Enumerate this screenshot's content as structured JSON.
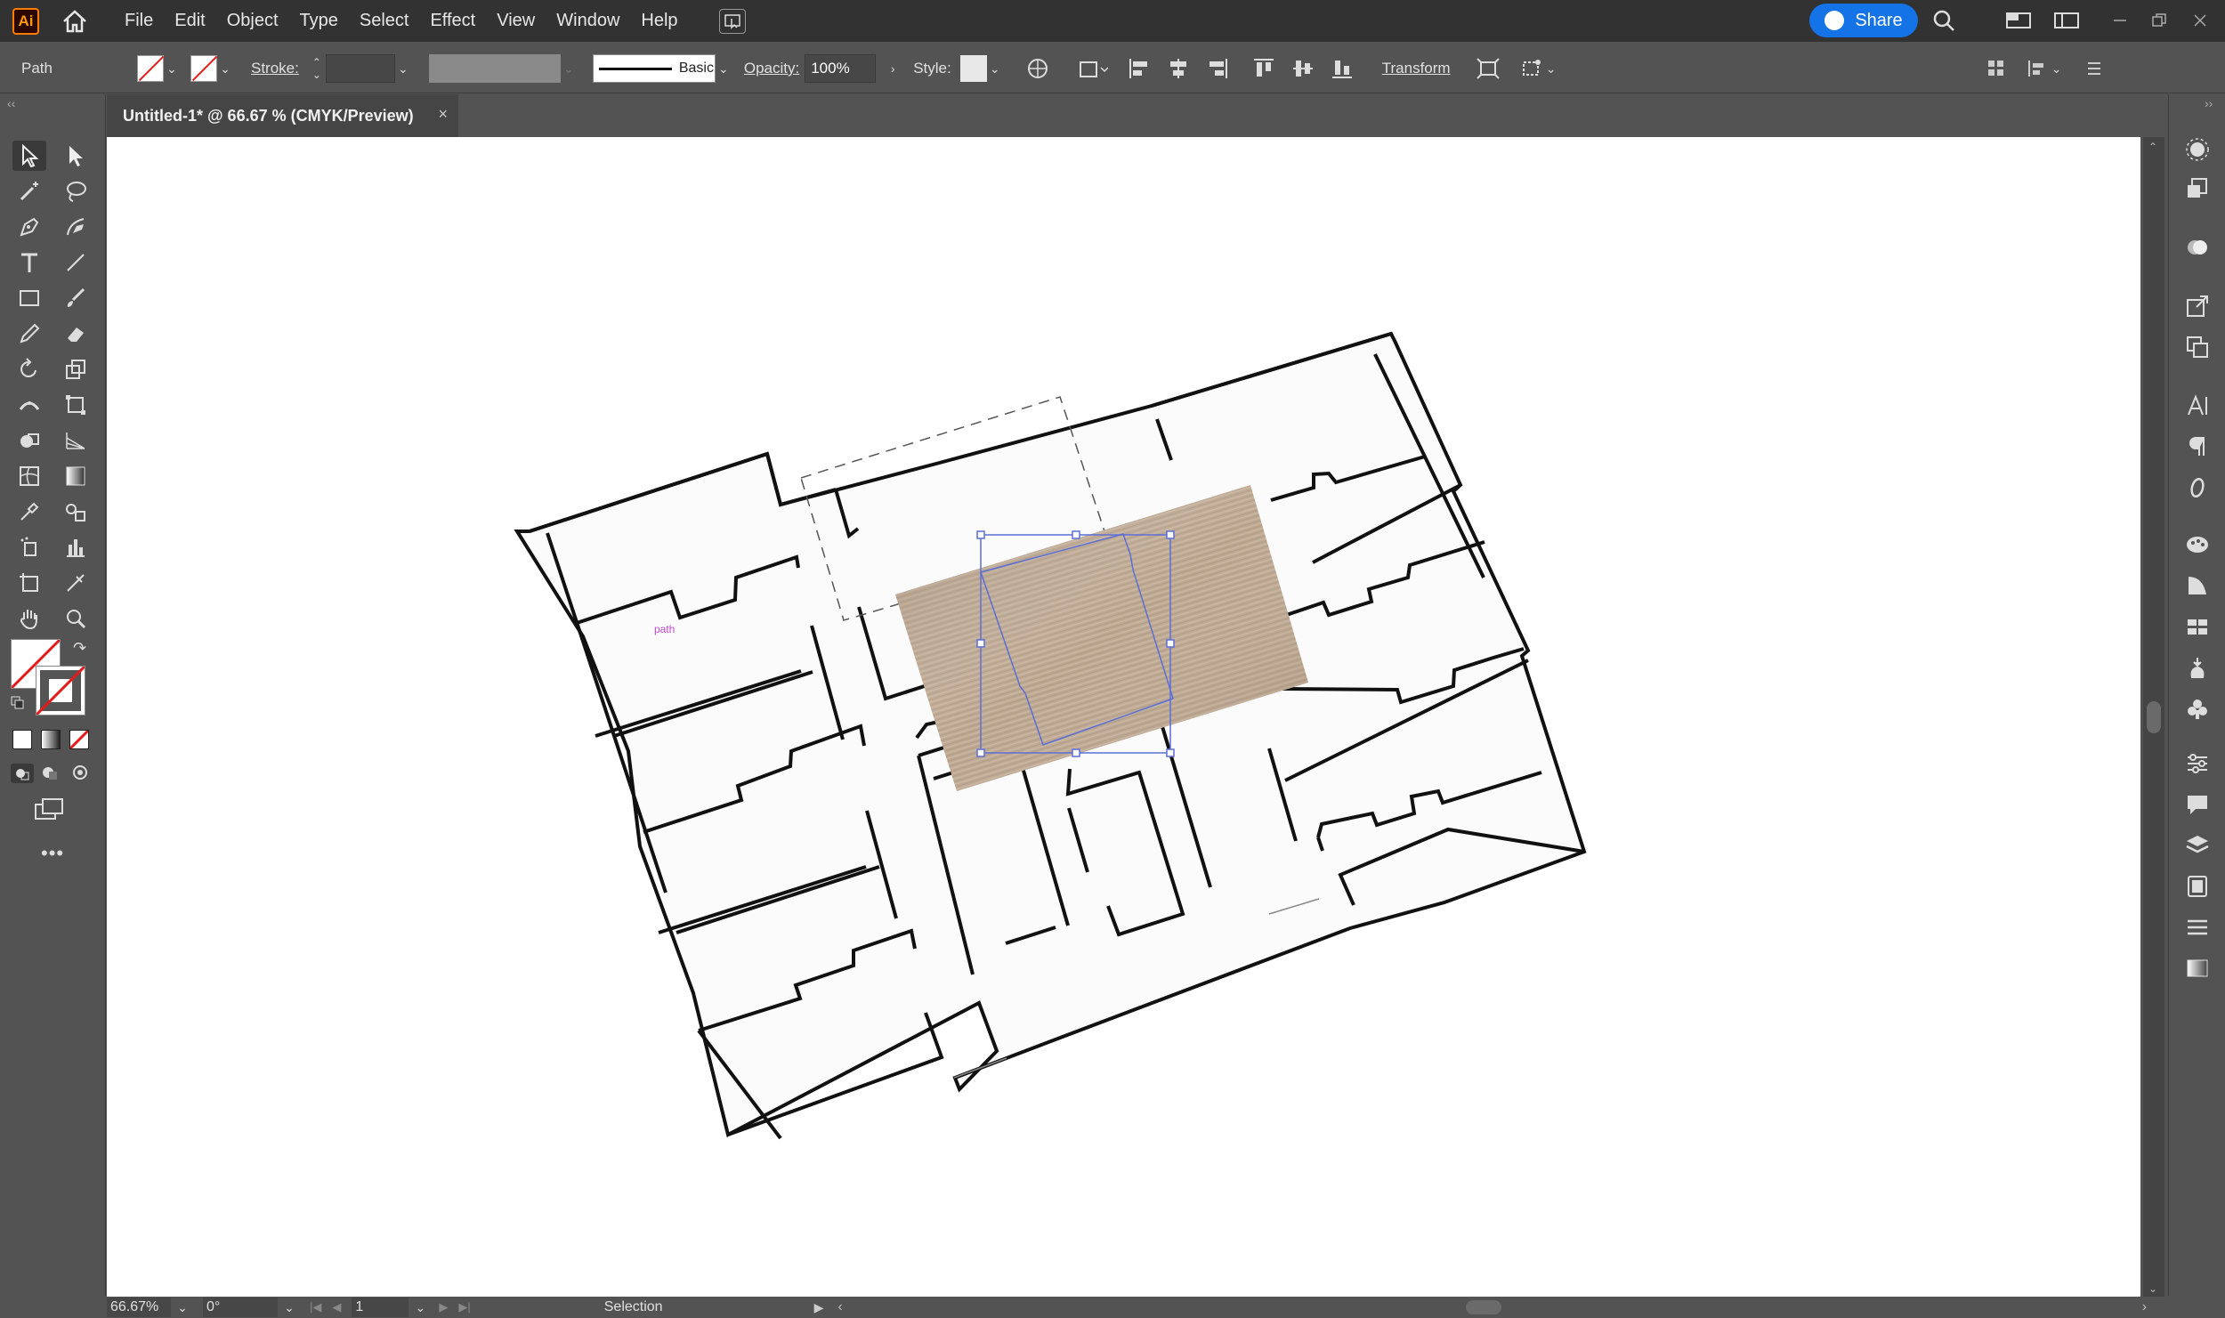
{
  "app": {
    "logo_text": "Ai"
  },
  "menu": [
    "File",
    "Edit",
    "Object",
    "Type",
    "Select",
    "Effect",
    "View",
    "Window",
    "Help"
  ],
  "share_label": "Share",
  "control_bar": {
    "selection_type": "Path",
    "stroke_label": "Stroke:",
    "brush_label": "Basic",
    "opacity_label": "Opacity:",
    "opacity_value": "100%",
    "style_label": "Style:",
    "transform_label": "Transform"
  },
  "document_tab": {
    "title": "Untitled-1* @ 66.67 % (CMYK/Preview)",
    "close": "×"
  },
  "canvas": {
    "path_hint": "path"
  },
  "status_bar": {
    "zoom": "66.67%",
    "rotation": "0°",
    "artboard_number": "1",
    "tool_name": "Selection"
  },
  "icons": [
    "home-icon",
    "workspace-icon",
    "search-icon",
    "arrange-icon",
    "selection-tool-icon",
    "direct-selection-icon",
    "pen-icon",
    "type-icon",
    "rectangle-icon",
    "brush-icon",
    "pencil-icon",
    "eraser-icon",
    "rotate-icon",
    "scale-icon",
    "eyedropper-icon",
    "zoom-icon",
    "hand-icon",
    "more-tools-icon"
  ],
  "colors": {
    "accent": "#1473e6",
    "selection": "#5c6ed6",
    "app_bg": "#535353",
    "menubar_bg": "#323232"
  }
}
